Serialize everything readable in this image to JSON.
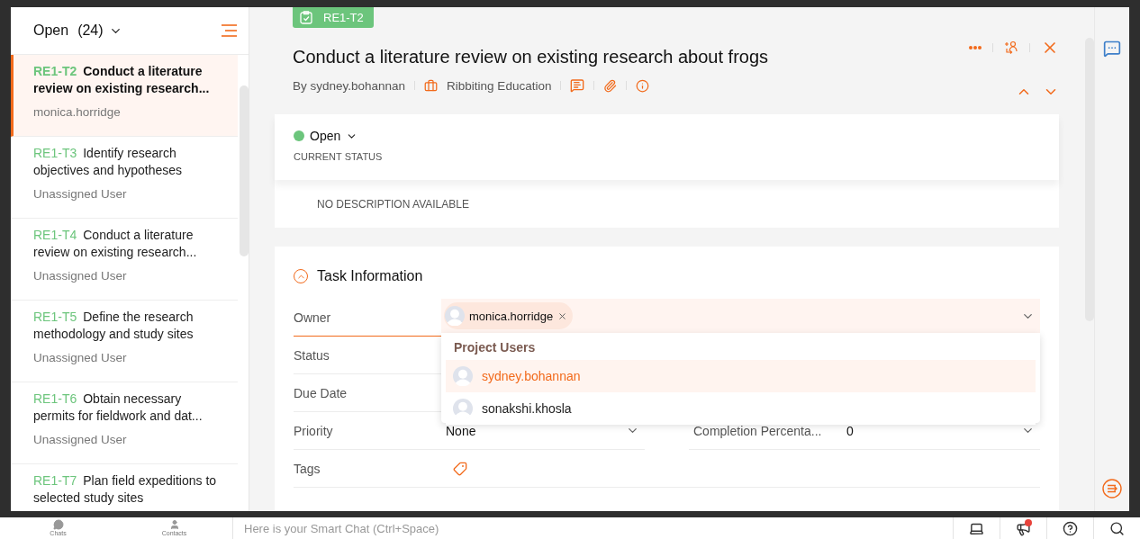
{
  "list_header": {
    "label": "Open",
    "count": "(24)"
  },
  "tasks": [
    {
      "id": "RE1-T2",
      "title": "Conduct a literature review on existing research...",
      "assignee": "monica.horridge",
      "selected": true
    },
    {
      "id": "RE1-T3",
      "title": "Identify research objectives and hypotheses",
      "assignee": "Unassigned User",
      "selected": false
    },
    {
      "id": "RE1-T4",
      "title": "Conduct a literature review on existing research...",
      "assignee": "Unassigned User",
      "selected": false
    },
    {
      "id": "RE1-T5",
      "title": "Define the research methodology and study sites",
      "assignee": "Unassigned User",
      "selected": false
    },
    {
      "id": "RE1-T6",
      "title": "Obtain necessary permits for fieldwork and dat...",
      "assignee": "Unassigned User",
      "selected": false
    },
    {
      "id": "RE1-T7",
      "title": "Plan field expeditions to selected study sites",
      "selected": false
    }
  ],
  "task": {
    "badge": "RE1-T2",
    "title": "Conduct a literature review on existing research about frogs",
    "author": "By sydney.bohannan",
    "project": "Ribbiting Education"
  },
  "status": {
    "value": "Open",
    "color": "#6cc57c",
    "caption": "CURRENT STATUS"
  },
  "description": {
    "text": "NO DESCRIPTION AVAILABLE"
  },
  "task_information": {
    "title": "Task Information",
    "expanded": true,
    "fields": [
      {
        "label": "Owner",
        "kind": "owner",
        "chips": [
          "monica.horridge"
        ],
        "focused": true
      },
      {
        "label": "Status",
        "kind": "empty"
      },
      {
        "label": "Due Date",
        "kind": "empty"
      },
      {
        "label": "Priority",
        "kind": "select",
        "value": "None",
        "pair": {
          "label": "Completion Percenta...",
          "value": "0"
        }
      },
      {
        "label": "Tags",
        "kind": "tags"
      }
    ]
  },
  "owner_dropdown": {
    "group": "Project Users",
    "options": [
      {
        "name": "sydney.bohannan",
        "selected": true
      },
      {
        "name": "sonakshi.khosla",
        "selected": false
      }
    ]
  },
  "bottom_bar": {
    "tabs": [
      {
        "label": "Chats",
        "kind": "chats"
      },
      {
        "label": "Contacts",
        "kind": "contacts"
      }
    ],
    "placeholder": "Here is your Smart Chat (Ctrl+Space)",
    "notification": true
  }
}
